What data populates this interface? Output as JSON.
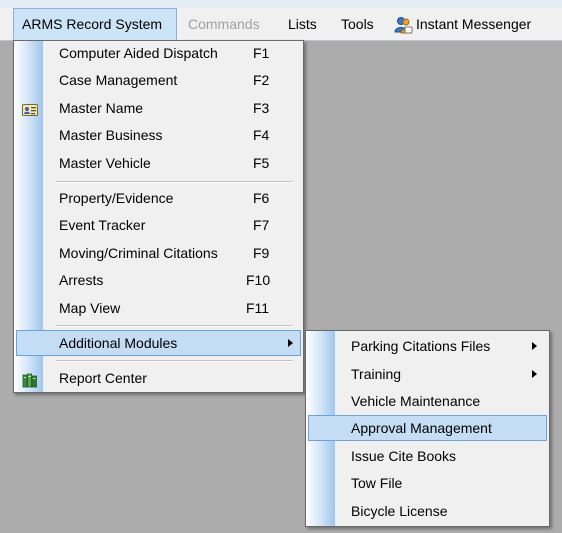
{
  "menubar": {
    "items": [
      {
        "label": "ARMS Record System",
        "state": "open"
      },
      {
        "label": "Commands",
        "state": "disabled"
      },
      {
        "label": "Lists"
      },
      {
        "label": "Tools"
      },
      {
        "label": "Instant Messenger",
        "icon": "users-chat-icon"
      }
    ]
  },
  "main_menu": {
    "items": [
      {
        "label": "Computer Aided Dispatch",
        "shortcut": "F1"
      },
      {
        "label": "Case Management",
        "shortcut": "F2"
      },
      {
        "label": "Master Name",
        "shortcut": "F3",
        "icon": "id-card-icon"
      },
      {
        "label": "Master Business",
        "shortcut": "F4"
      },
      {
        "label": "Master Vehicle",
        "shortcut": "F5"
      },
      {
        "label": "Property/Evidence",
        "shortcut": "F6"
      },
      {
        "label": "Event Tracker",
        "shortcut": "F7"
      },
      {
        "label": "Moving/Criminal Citations",
        "shortcut": "F9"
      },
      {
        "label": "Arrests",
        "shortcut": "F10"
      },
      {
        "label": "Map View",
        "shortcut": "F11"
      },
      {
        "label": "Additional Modules",
        "submenu": true,
        "state": "highlighted"
      },
      {
        "label": "Report Center",
        "icon": "report-books-icon"
      }
    ]
  },
  "submenu": {
    "items": [
      {
        "label": "Parking Citations Files",
        "submenu": true
      },
      {
        "label": "Training",
        "submenu": true
      },
      {
        "label": "Vehicle Maintenance"
      },
      {
        "label": "Approval Management",
        "state": "highlighted"
      },
      {
        "label": "Issue Cite Books"
      },
      {
        "label": "Tow File"
      },
      {
        "label": "Bicycle License"
      }
    ]
  },
  "colors": {
    "desktop": "#acacac",
    "menu_bg": "#f0f0f0",
    "highlight": "#c4dcf4",
    "highlight_border": "#6aa4dc",
    "disabled_text": "#a0a0a0"
  }
}
